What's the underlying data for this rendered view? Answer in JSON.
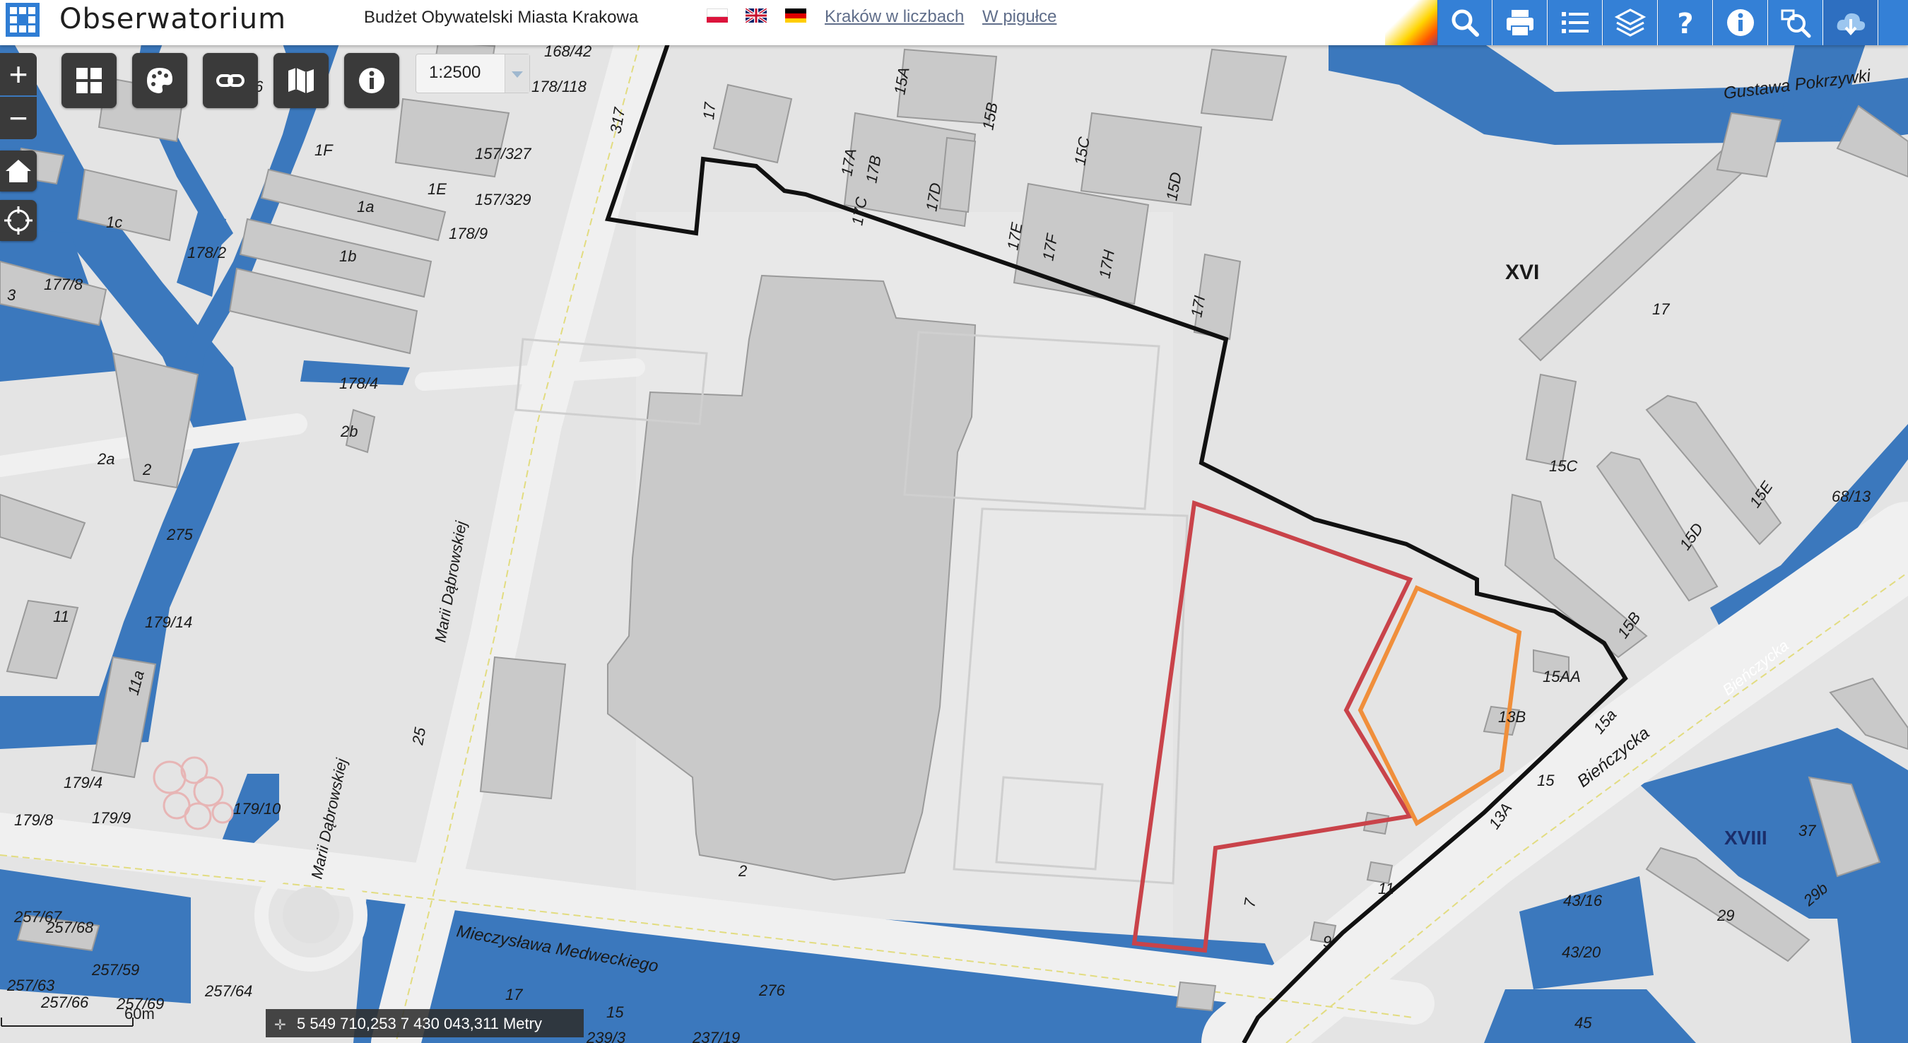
{
  "header": {
    "app_title": "Obserwatorium",
    "subtitle": "Budżet Obywatelski Miasta Krakowa",
    "languages": [
      "pl",
      "en",
      "de"
    ],
    "links": [
      "Kraków w liczbach",
      "W pigułce"
    ]
  },
  "toolbar": {
    "buttons": [
      "search-icon",
      "print-icon",
      "legend-list-icon",
      "layers-icon",
      "help-icon",
      "info-icon",
      "search-zoom-icon",
      "download-icon"
    ]
  },
  "map_controls": {
    "zoom_in": "+",
    "zoom_out": "−",
    "scale": "1:2500",
    "buttons": [
      "grid-icon",
      "palette-icon",
      "link-icon",
      "map-icon",
      "info-icon"
    ]
  },
  "status": {
    "coordinates": "5 549 710,253 7 430 043,311 Metry",
    "scale_bar": "60m"
  },
  "map_labels": {
    "streets": [
      "Gustawa Pokrzywki",
      "Marii Dąbrowskiej",
      "Marii Dąbrowskiej",
      "Mieczysława Medweckiego",
      "Bieńczycka",
      "Bieńczycka"
    ],
    "districts": [
      "XVI",
      "XVIII"
    ],
    "numbers": [
      "168/42",
      "178/118",
      "317",
      "17",
      "15A",
      "15B",
      "15C",
      "15D",
      "17A",
      "17B",
      "17C",
      "17D",
      "17E",
      "17F",
      "17H",
      "17I",
      "1E",
      "1F",
      "157/327",
      "157/329",
      "1a",
      "1b",
      "1c",
      "178/9",
      "178/2",
      "177/8",
      "3",
      "6",
      "178/4",
      "2b",
      "2a",
      "2",
      "275",
      "179/14",
      "11",
      "11a",
      "25",
      "179/4",
      "179/8",
      "179/9",
      "179/10",
      "2",
      "257/67",
      "257/68",
      "257/59",
      "257/63",
      "257/66",
      "257/69",
      "257/64",
      "17",
      "15",
      "239/3",
      "237/19",
      "276",
      "7",
      "11",
      "9",
      "13A",
      "13B",
      "15",
      "15a",
      "15AA",
      "15B",
      "15D",
      "15E",
      "15C",
      "17",
      "68/13",
      "43/16",
      "43/20",
      "45",
      "29",
      "29b",
      "37"
    ]
  },
  "colors": {
    "header_blue": "#3480d6",
    "parcel_blue": "#3b78bd",
    "boundary_black": "#111111",
    "area_red": "#c9434a",
    "area_orange": "#f08f3b",
    "building": "#c9c9c9"
  }
}
